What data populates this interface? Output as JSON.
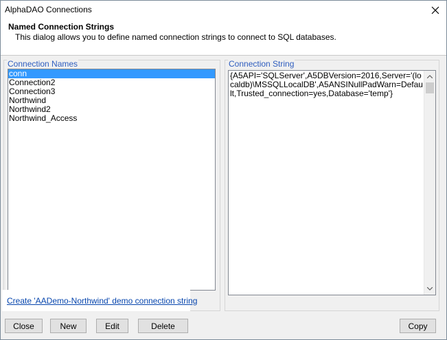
{
  "window": {
    "title": "AlphaDAO Connections"
  },
  "header": {
    "title": "Named Connection Strings",
    "description": "This dialog allows you to define named connection strings to connect to SQL databases."
  },
  "connections_panel": {
    "label": "Connection Names",
    "items": [
      {
        "label": "conn",
        "selected": true
      },
      {
        "label": "Connection2",
        "selected": false
      },
      {
        "label": "Connection3",
        "selected": false
      },
      {
        "label": "Northwind",
        "selected": false
      },
      {
        "label": "Northwind2",
        "selected": false
      },
      {
        "label": "Northwind_Access",
        "selected": false
      }
    ]
  },
  "connection_string_panel": {
    "label": "Connection String",
    "value": "{A5API='SQLServer',A5DBVersion=2016,Server='(localdb)\\MSSQLLocalDB',A5ANSINullPadWarn=Default,Trusted_connection=yes,Database='temp'}"
  },
  "demo_link": {
    "text": "Create 'AADemo-Northwind' demo connection string"
  },
  "buttons": {
    "close": "Close",
    "new": "New",
    "edit": "Edit",
    "delete": "Delete",
    "copy": "Copy"
  },
  "icons": {
    "close": "close-icon",
    "scroll_up": "chevron-up-icon",
    "scroll_down": "chevron-down-icon"
  },
  "colors": {
    "selection": "#3399ff",
    "panel_label": "#2e5dbf",
    "link": "#0645ad"
  }
}
